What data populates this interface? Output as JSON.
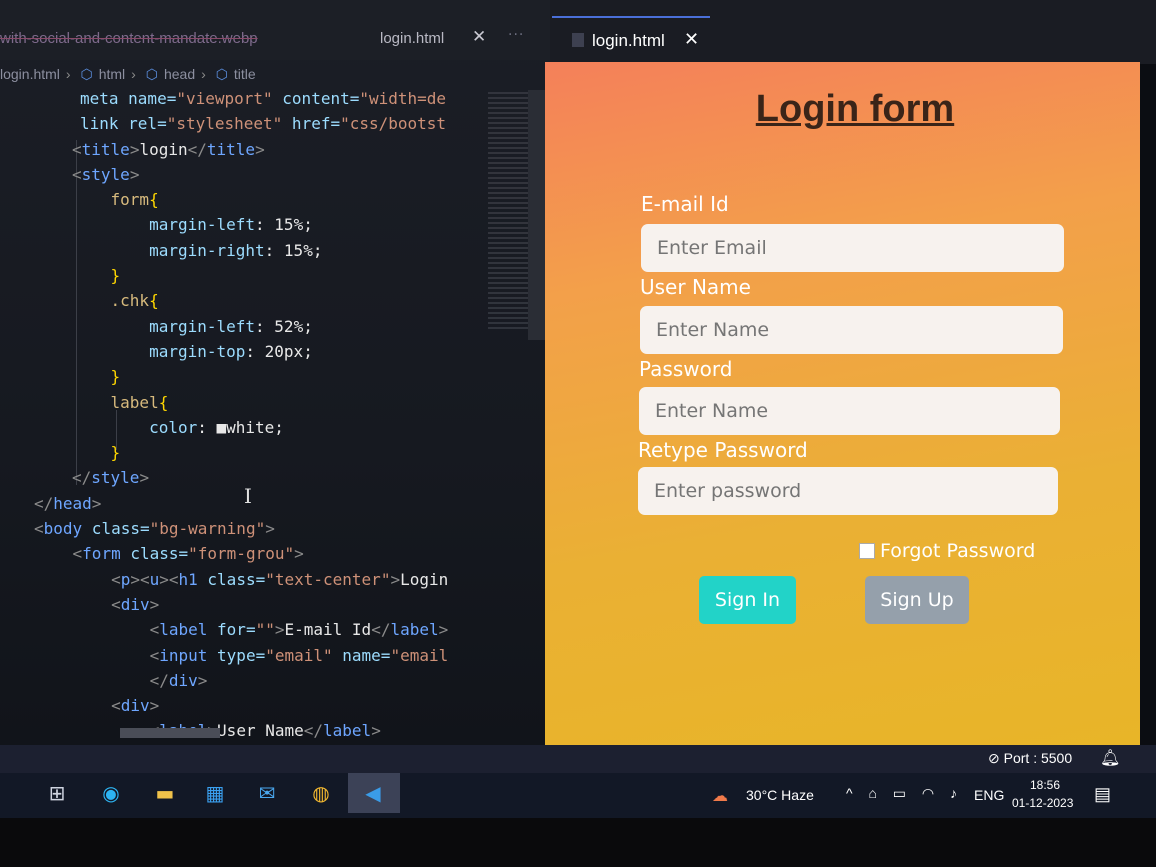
{
  "editor": {
    "tab_previous": "with-social-and-content-mandate.webp",
    "tab_active": "login.html",
    "breadcrumbs": [
      "login.html",
      "html",
      "head",
      "title"
    ],
    "code_lines": [
      {
        "segs": [
          [
            "attr",
            "meta name="
          ],
          [
            "str",
            "\"viewport\""
          ],
          [
            "attr",
            " content="
          ],
          [
            "str",
            "\"width=de"
          ]
        ]
      },
      {
        "segs": [
          [
            "attr",
            "link rel="
          ],
          [
            "str",
            "\"stylesheet\""
          ],
          [
            "attr",
            " href="
          ],
          [
            "str",
            "\"css/bootst"
          ]
        ]
      },
      {
        "segs": [
          [
            "brkt",
            "<"
          ],
          [
            "tag",
            "title"
          ],
          [
            "brkt",
            ">"
          ],
          [
            "val",
            "login"
          ],
          [
            "brkt",
            "</"
          ],
          [
            "tag",
            "title"
          ],
          [
            "brkt",
            ">"
          ]
        ]
      },
      {
        "segs": [
          [
            "brkt",
            "<"
          ],
          [
            "tag",
            "style"
          ],
          [
            "brkt",
            ">"
          ]
        ]
      },
      {
        "segs": [
          [
            "sel",
            "    form"
          ],
          [
            "brace",
            "{"
          ]
        ]
      },
      {
        "segs": [
          [
            "prop",
            "        margin-left"
          ],
          [
            "val",
            ": 15%;"
          ]
        ]
      },
      {
        "segs": [
          [
            "prop",
            "        margin-right"
          ],
          [
            "val",
            ": 15%;"
          ]
        ]
      },
      {
        "segs": [
          [
            "brace",
            "    }"
          ]
        ]
      },
      {
        "segs": [
          [
            "sel",
            "    .chk"
          ],
          [
            "brace",
            "{"
          ]
        ]
      },
      {
        "segs": [
          [
            "prop",
            "        margin-left"
          ],
          [
            "val",
            ": 52%;"
          ]
        ]
      },
      {
        "segs": [
          [
            "prop",
            "        margin-top"
          ],
          [
            "val",
            ": 20px;"
          ]
        ]
      },
      {
        "segs": [
          [
            "brace",
            "    }"
          ]
        ]
      },
      {
        "segs": [
          [
            "sel",
            "    label"
          ],
          [
            "brace",
            "{"
          ]
        ]
      },
      {
        "segs": [
          [
            "prop",
            "        color"
          ],
          [
            "val",
            ": ■white;"
          ]
        ]
      },
      {
        "segs": [
          [
            "brace",
            "    }"
          ]
        ]
      },
      {
        "segs": [
          [
            "brkt",
            "</"
          ],
          [
            "tag",
            "style"
          ],
          [
            "brkt",
            ">"
          ]
        ]
      },
      {
        "segs": [
          [
            "brkt",
            "</"
          ],
          [
            "tag",
            "head"
          ],
          [
            "brkt",
            ">"
          ]
        ]
      },
      {
        "segs": [
          [
            "brkt",
            "<"
          ],
          [
            "tag",
            "body"
          ],
          [
            "attr",
            " class="
          ],
          [
            "str",
            "\"bg-warning\""
          ],
          [
            "brkt",
            ">"
          ]
        ]
      },
      {
        "segs": [
          [
            "brkt",
            "    <"
          ],
          [
            "tag",
            "form"
          ],
          [
            "attr",
            " class="
          ],
          [
            "str",
            "\"form-grou\""
          ],
          [
            "brkt",
            ">"
          ]
        ]
      },
      {
        "segs": [
          [
            "brkt",
            "        <"
          ],
          [
            "tag",
            "p"
          ],
          [
            "brkt",
            "><"
          ],
          [
            "tag",
            "u"
          ],
          [
            "brkt",
            "><"
          ],
          [
            "tag",
            "h1"
          ],
          [
            "attr",
            " class="
          ],
          [
            "str",
            "\"text-center\""
          ],
          [
            "brkt",
            ">"
          ],
          [
            "val",
            "Login"
          ]
        ]
      },
      {
        "segs": [
          [
            "brkt",
            "        <"
          ],
          [
            "tag",
            "div"
          ],
          [
            "brkt",
            ">"
          ]
        ]
      },
      {
        "segs": [
          [
            "brkt",
            "            <"
          ],
          [
            "tag",
            "label"
          ],
          [
            "attr",
            " for="
          ],
          [
            "str",
            "\"\""
          ],
          [
            "brkt",
            ">"
          ],
          [
            "val",
            "E-mail Id"
          ],
          [
            "brkt",
            "</"
          ],
          [
            "tag",
            "label"
          ],
          [
            "brkt",
            ">"
          ]
        ]
      },
      {
        "segs": [
          [
            "brkt",
            "            <"
          ],
          [
            "tag",
            "input"
          ],
          [
            "attr",
            " type="
          ],
          [
            "str",
            "\"email\""
          ],
          [
            "attr",
            " name="
          ],
          [
            "str",
            "\"email"
          ]
        ]
      },
      {
        "segs": [
          [
            "brkt",
            "            </"
          ],
          [
            "tag",
            "div"
          ],
          [
            "brkt",
            ">"
          ]
        ]
      },
      {
        "segs": [
          [
            "brkt",
            "        <"
          ],
          [
            "tag",
            "div"
          ],
          [
            "brkt",
            ">"
          ]
        ]
      },
      {
        "segs": [
          [
            "brkt",
            "            <"
          ],
          [
            "tag",
            "label"
          ],
          [
            "brkt",
            ">"
          ],
          [
            "val",
            "User Name"
          ],
          [
            "brkt",
            "</"
          ],
          [
            "tag",
            "label"
          ],
          [
            "brkt",
            ">"
          ]
        ]
      }
    ]
  },
  "preview": {
    "tab_label": "login.html",
    "title": "Login form",
    "fields": [
      {
        "label": "E-mail Id",
        "placeholder": "Enter Email"
      },
      {
        "label": "User Name",
        "placeholder": "Enter Name"
      },
      {
        "label": "Password",
        "placeholder": "Enter Name"
      },
      {
        "label": "Retype Password",
        "placeholder": "Enter password"
      }
    ],
    "checkbox_label": "Forgot Password",
    "signin_label": "Sign In",
    "signup_label": "Sign Up"
  },
  "status": {
    "port": "Port : 5500"
  },
  "taskbar": {
    "weather": "30°C  Haze",
    "language": "ENG",
    "time": "18:56",
    "date": "01-12-2023"
  }
}
